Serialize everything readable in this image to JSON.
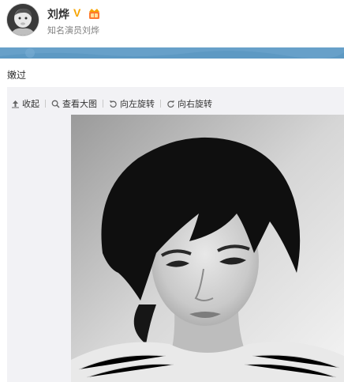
{
  "user": {
    "name": "刘烨",
    "verified_mark": "V",
    "subtitle": "知名演员刘烨"
  },
  "post": {
    "text": "嫩过"
  },
  "toolbar": {
    "collapse": "收起",
    "view_large": "查看大图",
    "rotate_left": "向左旋转",
    "rotate_right": "向右旋转"
  },
  "icons": [
    "avatar",
    "verified-icon",
    "vip-badge-icon",
    "collapse-icon",
    "zoom-icon",
    "rotate-left-icon",
    "rotate-right-icon"
  ],
  "colors": {
    "banner": "#67a0c9",
    "verified": "#f6a400",
    "media_bg": "#f2f2f5"
  }
}
